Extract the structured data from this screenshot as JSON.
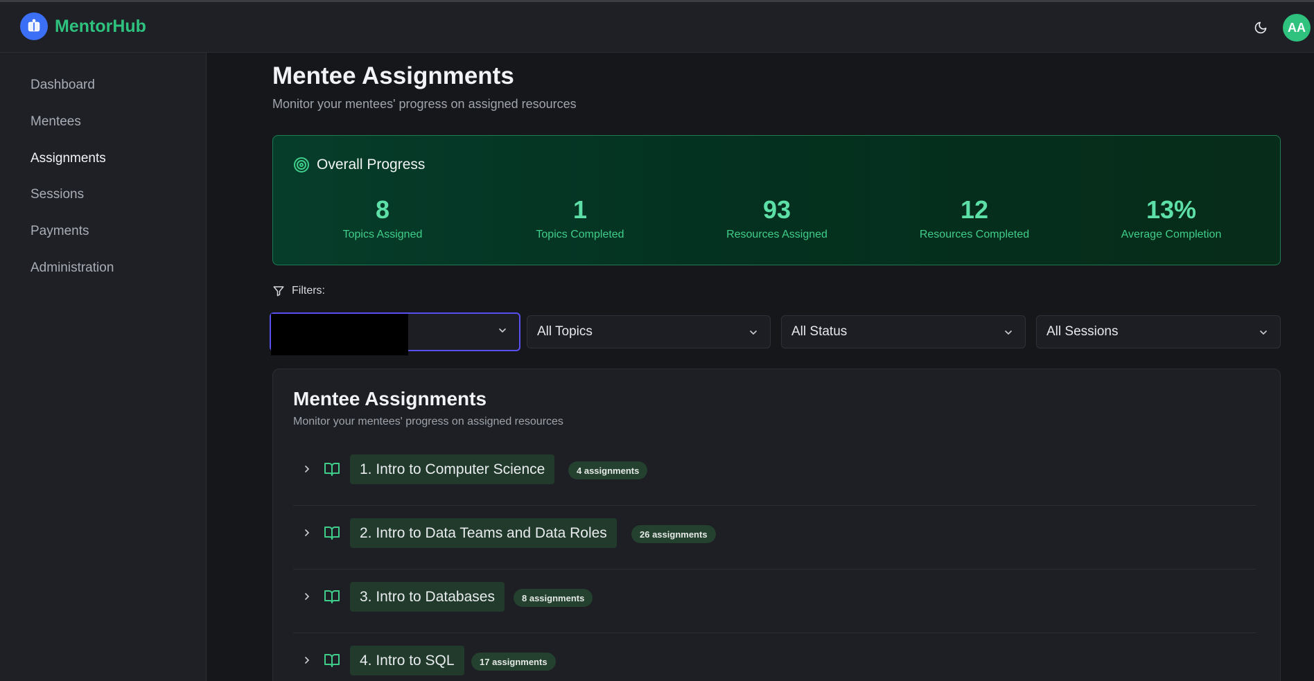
{
  "app": {
    "name": "MentorHub",
    "user_initials": "AA"
  },
  "sidebar": {
    "items": [
      {
        "label": "Dashboard"
      },
      {
        "label": "Mentees"
      },
      {
        "label": "Assignments"
      },
      {
        "label": "Sessions"
      },
      {
        "label": "Payments"
      },
      {
        "label": "Administration"
      }
    ]
  },
  "page": {
    "title": "Mentee Assignments",
    "subtitle": "Monitor your mentees' progress on assigned resources"
  },
  "overall": {
    "title": "Overall Progress",
    "stats": [
      {
        "value": "8",
        "label": "Topics Assigned"
      },
      {
        "value": "1",
        "label": "Topics Completed"
      },
      {
        "value": "93",
        "label": "Resources Assigned"
      },
      {
        "value": "12",
        "label": "Resources Completed"
      },
      {
        "value": "13%",
        "label": "Average Completion"
      }
    ]
  },
  "filters": {
    "label": "Filters:",
    "mentee": "",
    "topics": "All Topics",
    "status": "All Status",
    "sessions": "All Sessions"
  },
  "list": {
    "title": "Mentee Assignments",
    "subtitle": "Monitor your mentees' progress on assigned resources",
    "topics": [
      {
        "name": "1. Intro to Computer Science",
        "badge": "4 assignments"
      },
      {
        "name": "2. Intro to Data Teams and Data Roles",
        "badge": "26 assignments"
      },
      {
        "name": "3. Intro to Databases",
        "badge": "8 assignments"
      },
      {
        "name": "4. Intro to SQL",
        "badge": "17 assignments"
      }
    ]
  },
  "colors": {
    "accent": "#2ec27e",
    "brand_logo": "#3b6ff5",
    "focus": "#5a4ff0"
  }
}
